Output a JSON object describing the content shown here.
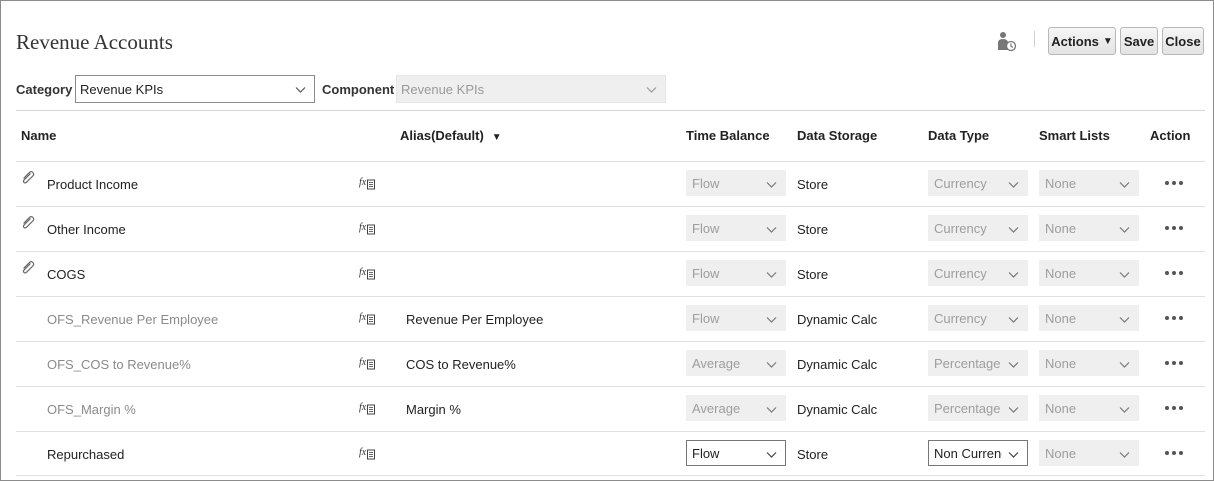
{
  "page": {
    "title": "Revenue Accounts"
  },
  "toolbar": {
    "actions_label": "Actions",
    "save_label": "Save",
    "close_label": "Close"
  },
  "filters": {
    "category_label": "Category",
    "category_value": "Revenue KPIs",
    "component_label": "Component",
    "component_value": "Revenue KPIs"
  },
  "table": {
    "headers": {
      "name": "Name",
      "alias": "Alias(Default)",
      "time_balance": "Time Balance",
      "data_storage": "Data Storage",
      "data_type": "Data Type",
      "smart_lists": "Smart Lists",
      "action": "Action"
    },
    "rows": [
      {
        "name": "Product Income",
        "linked": true,
        "muted": false,
        "alias": "",
        "time_balance": "Flow",
        "data_storage": "Store",
        "data_type": "Currency",
        "smart_list": "None",
        "editable": false
      },
      {
        "name": "Other Income",
        "linked": true,
        "muted": false,
        "alias": "",
        "time_balance": "Flow",
        "data_storage": "Store",
        "data_type": "Currency",
        "smart_list": "None",
        "editable": false
      },
      {
        "name": "COGS",
        "linked": true,
        "muted": false,
        "alias": "",
        "time_balance": "Flow",
        "data_storage": "Store",
        "data_type": "Currency",
        "smart_list": "None",
        "editable": false
      },
      {
        "name": "OFS_Revenue Per Employee",
        "linked": false,
        "muted": true,
        "alias": "Revenue Per Employee",
        "time_balance": "Flow",
        "data_storage": "Dynamic Calc",
        "data_type": "Currency",
        "smart_list": "None",
        "editable": false
      },
      {
        "name": "OFS_COS to Revenue%",
        "linked": false,
        "muted": true,
        "alias": "COS to Revenue%",
        "time_balance": "Average",
        "data_storage": "Dynamic Calc",
        "data_type": "Percentage",
        "smart_list": "None",
        "editable": false
      },
      {
        "name": "OFS_Margin %",
        "linked": false,
        "muted": true,
        "alias": "Margin %",
        "time_balance": "Average",
        "data_storage": "Dynamic Calc",
        "data_type": "Percentage",
        "smart_list": "None",
        "editable": false
      },
      {
        "name": "Repurchased",
        "linked": false,
        "muted": false,
        "alias": "",
        "time_balance": "Flow",
        "data_storage": "Store",
        "data_type": "Non Currency",
        "smart_list": "None",
        "editable": true
      }
    ]
  }
}
